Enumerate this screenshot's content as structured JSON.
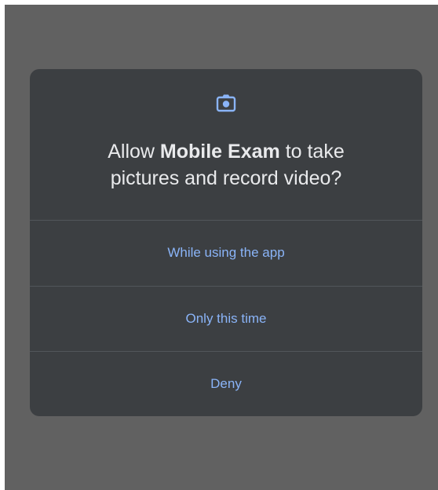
{
  "dialog": {
    "icon": "camera-icon",
    "title_prefix": "Allow ",
    "app_name": "Mobile Exam",
    "title_line1_suffix": " to take",
    "title_line2": "pictures and record video?",
    "options": [
      {
        "label": "While using the app"
      },
      {
        "label": "Only this time"
      },
      {
        "label": "Deny"
      }
    ]
  },
  "colors": {
    "scrim": "#616161",
    "dialog_bg": "#3c3f42",
    "accent": "#8ab4f8",
    "title_text": "#e9eaec",
    "divider": "#52565a"
  }
}
